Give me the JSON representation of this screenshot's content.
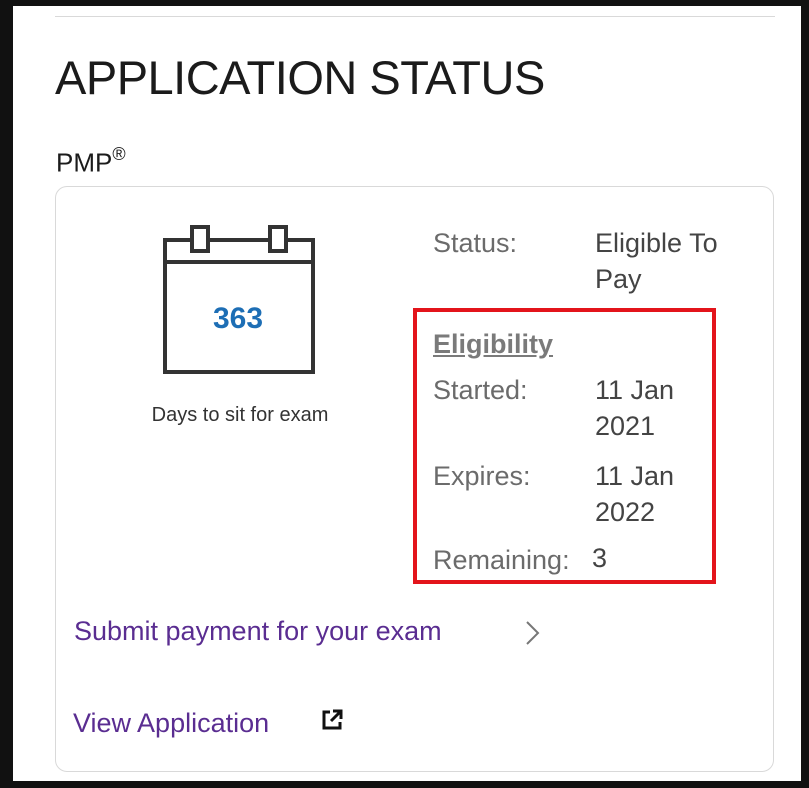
{
  "page": {
    "title": "APPLICATION STATUS"
  },
  "program": {
    "name": "PMP",
    "registered_mark": "®"
  },
  "exam_countdown": {
    "days": "363",
    "caption": "Days to sit for exam",
    "icon": "calendar-icon"
  },
  "status": {
    "label": "Status:",
    "value": "Eligible To Pay"
  },
  "eligibility": {
    "heading": "Eligibility",
    "started_label": "Started:",
    "started_value": "11 Jan 2021",
    "expires_label": "Expires:",
    "expires_value": "11 Jan 2022",
    "remaining_label": "Remaining:",
    "remaining_value": "3",
    "highlight_color": "#e3141b"
  },
  "actions": {
    "submit_payment": "Submit payment for your exam",
    "submit_payment_icon": "chevron-right-icon",
    "view_application": "View Application",
    "view_application_icon": "external-link-icon"
  },
  "colors": {
    "link": "#5a2d91",
    "days_accent": "#1d6eb5",
    "title_text": "#1b1b1b"
  }
}
